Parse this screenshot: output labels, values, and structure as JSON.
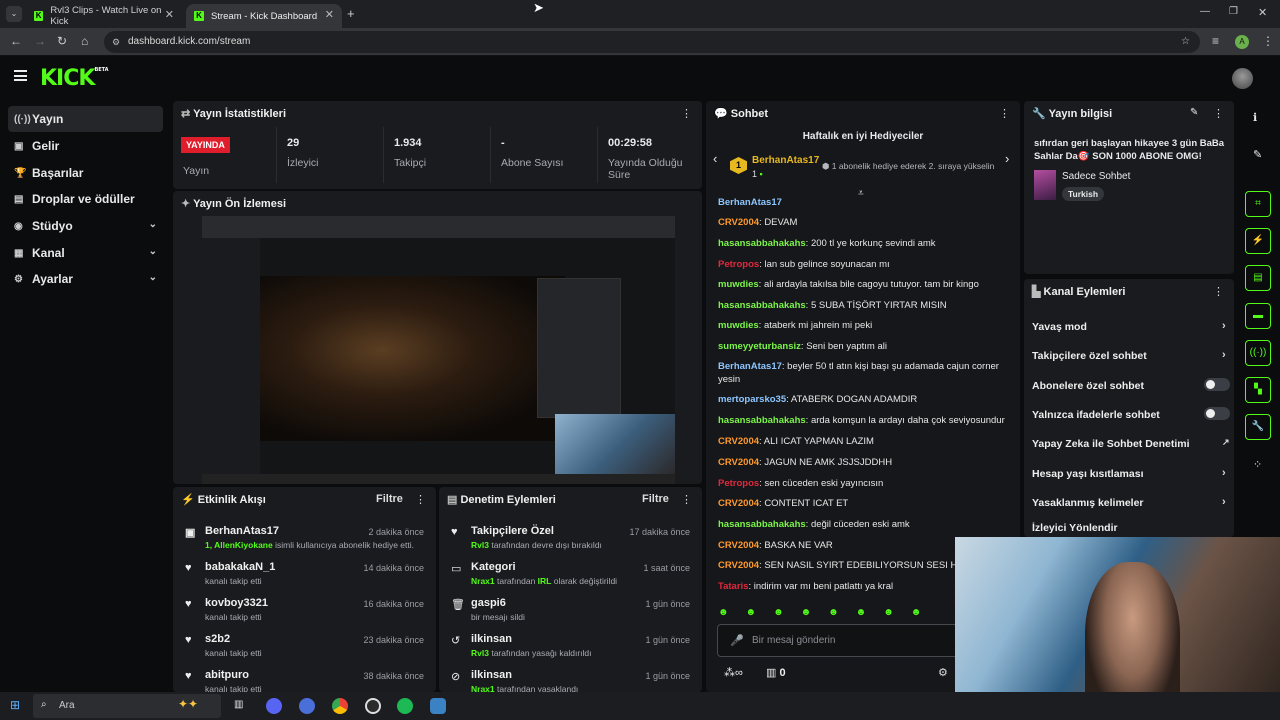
{
  "browser": {
    "tabs": [
      {
        "title": "Rvl3 Clips - Watch Live on Kick"
      },
      {
        "title": "Stream - Kick Dashboard"
      }
    ],
    "url": "dashboard.kick.com/stream",
    "profile_initial": "A"
  },
  "logo": {
    "text": "KICK",
    "badge": "BETA"
  },
  "sidebar": {
    "items": [
      {
        "label": "Yayın",
        "icon": "radio-icon"
      },
      {
        "label": "Gelir",
        "icon": "revenue-icon"
      },
      {
        "label": "Başarılar",
        "icon": "trophy-icon"
      },
      {
        "label": "Droplar ve ödüller",
        "icon": "gift-icon"
      },
      {
        "label": "Stüdyo",
        "icon": "studio-icon"
      },
      {
        "label": "Kanal",
        "icon": "channel-icon"
      },
      {
        "label": "Ayarlar",
        "icon": "gear-icon"
      }
    ]
  },
  "stats": {
    "title": "Yayın İstatistikleri",
    "live_badge": "YAYINDA",
    "items": [
      {
        "value": "",
        "label": "Yayın"
      },
      {
        "value": "29",
        "label": "İzleyici"
      },
      {
        "value": "1.934",
        "label": "Takipçi"
      },
      {
        "value": "-",
        "label": "Abone Sayısı"
      },
      {
        "value": "00:29:58",
        "label": "Yayında Olduğu Süre"
      }
    ]
  },
  "preview": {
    "title": "Yayın Ön İzlemesi"
  },
  "activity": {
    "title": "Etkinlik Akışı",
    "filter": "Filtre",
    "rows": [
      {
        "name": "BerhanAtas17",
        "sub_user": "1, AllenKiyokane",
        "sub": "isimli kullanıcıya abonelik hediye etti.",
        "time": "2 dakika önce",
        "icon": "gift-icon"
      },
      {
        "name": "babakakaN_1",
        "sub": "kanalı takip etti",
        "time": "14 dakika önce",
        "icon": "heart-icon"
      },
      {
        "name": "kovboy3321",
        "sub": "kanalı takip etti",
        "time": "16 dakika önce",
        "icon": "heart-icon"
      },
      {
        "name": "s2b2",
        "sub": "kanalı takip etti",
        "time": "23 dakika önce",
        "icon": "heart-icon"
      },
      {
        "name": "abitpuro",
        "sub": "kanalı takip etti",
        "time": "38 dakika önce",
        "icon": "heart-icon"
      }
    ]
  },
  "moderation": {
    "title": "Denetim Eylemleri",
    "filter": "Filtre",
    "rows": [
      {
        "name": "Takipçilere Özel",
        "actor": "Rvl3",
        "sub": "tarafından devre dışı bırakıldı",
        "time": "17 dakika önce",
        "icon": "heart-icon"
      },
      {
        "name": "Kategori",
        "actor": "Nrax1",
        "sub": "tarafından",
        "target": "IRL",
        "sub2": "olarak değiştirildi",
        "time": "1 saat önce",
        "icon": "category-icon"
      },
      {
        "name": "gaspi6",
        "sub": "bir mesajı sildi",
        "time": "1 gün önce",
        "icon": "trash-icon"
      },
      {
        "name": "ilkinsan",
        "actor": "Rvl3",
        "sub": "tarafından yasağı kaldırıldı",
        "time": "1 gün önce",
        "icon": "undo-icon"
      },
      {
        "name": "ilkinsan",
        "actor": "Nrax1",
        "sub": "tarafından yasaklandı",
        "time": "1 gün önce",
        "icon": "ban-icon"
      }
    ]
  },
  "chat": {
    "title": "Sohbet",
    "gifters_title": "Haftalık en iyi Hediyeciler",
    "top_gifter": {
      "rank": "1",
      "name": "BerhanAtas17",
      "count": "1",
      "note": "1 abonelik hediye ederek 2. sıraya yükselin"
    },
    "partial_user": "BerhanAtas17",
    "messages": [
      {
        "user": "CRV2004",
        "color": "or",
        "text": "DEVAM"
      },
      {
        "user": "hasansabbahakahs",
        "color": "gr",
        "text": "200 tl ye korkunç sevindi amk"
      },
      {
        "user": "Petropos",
        "color": "rd",
        "text": "lan sub gelince soyunacan mı"
      },
      {
        "user": "muwdies",
        "color": "gr",
        "text": "ali ardayla takılsa bile cagoyu tutuyor. tam bir kingo"
      },
      {
        "user": "hasansabbahakahs",
        "color": "gr",
        "text": "5 SUBA TİŞÖRT YIRTAR MISIN"
      },
      {
        "user": "muwdies",
        "color": "gr",
        "text": "ataberk mi jahrein mi peki"
      },
      {
        "user": "sumeyyeturbansiz",
        "color": "gr",
        "text": "Seni ben yaptım ali"
      },
      {
        "user": "BerhanAtas17",
        "color": "bl",
        "text": "beyler 50 tl atın kişi başı şu adamada cajun corner yesin"
      },
      {
        "user": "mertoparsko35",
        "color": "bl",
        "text": "ATABERK DOGAN ADAMDIR"
      },
      {
        "user": "hasansabbahakahs",
        "color": "gr",
        "text": "arda komşun la ardayı daha çok seviyosundur"
      },
      {
        "user": "CRV2004",
        "color": "or",
        "text": "ALI ICAT YAPMAN LAZIM"
      },
      {
        "user": "CRV2004",
        "color": "or",
        "text": "JAGUN NE AMK JSJSJDDHH"
      },
      {
        "user": "Petropos",
        "color": "rd",
        "text": "sen cüceden eski yayıncısın"
      },
      {
        "user": "CRV2004",
        "color": "or",
        "text": "CONTENT ICAT ET"
      },
      {
        "user": "hasansabbahakahs",
        "color": "gr",
        "text": "değil cüceden eski amk"
      },
      {
        "user": "CRV2004",
        "color": "or",
        "text": "BASKA NE VAR"
      },
      {
        "user": "CRV2004",
        "color": "or",
        "text": "SEN NASIL SYIRT EDEBILIYORSUN SESI HARIC"
      },
      {
        "user": "Tataris",
        "color": "rd",
        "text": "indirim var mı beni patlattı ya kral"
      }
    ],
    "input_placeholder": "Bir mesaj gönderin",
    "footer_infinity": "∞",
    "footer_count": "0"
  },
  "stream_info": {
    "title": "Yayın bilgisi",
    "stream_title": "sıfırdan geri başlayan hikayee 3 gün BaBa Sahlar Da🎯 SON 1000 ABONE OMG!",
    "category": "Sadece Sohbet",
    "language": "Turkish"
  },
  "channel_actions": {
    "title": "Kanal Eylemleri",
    "items": [
      {
        "label": "Yavaş mod",
        "kind": "arrow"
      },
      {
        "label": "Takipçilere özel sohbet",
        "kind": "arrow"
      },
      {
        "label": "Abonelere özel sohbet",
        "kind": "toggle"
      },
      {
        "label": "Yalnızca ifadelerle sohbet",
        "kind": "toggle"
      },
      {
        "label": "Yapay Zeka ile Sohbet Denetimi",
        "kind": "external"
      },
      {
        "label": "Hesap yaşı kısıtlaması",
        "kind": "arrow"
      },
      {
        "label": "Yasaklanmış kelimeler",
        "kind": "arrow"
      },
      {
        "label": "İzleyici Yönlendir",
        "kind": "none"
      }
    ]
  },
  "taskbar": {
    "search_placeholder": "Ara"
  },
  "colors": {
    "accent": "#53fc18",
    "live": "#e01d2a",
    "panel": "#191b1f",
    "bg": "#0b0c0e"
  }
}
